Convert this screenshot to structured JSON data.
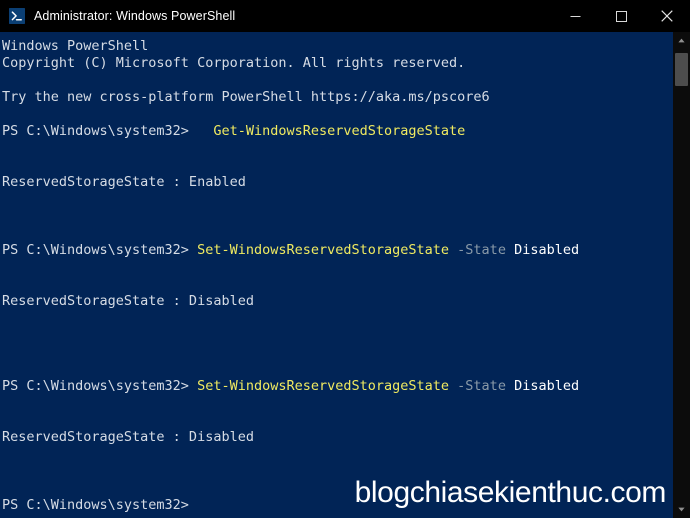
{
  "window": {
    "title": "Administrator: Windows PowerShell",
    "icon": "powershell-icon",
    "background_color": "#012456",
    "titlebar_color": "#000000",
    "controls": {
      "minimize": "minimize-icon",
      "maximize": "maximize-icon",
      "close": "close-icon"
    }
  },
  "scrollbar": {
    "up_arrow": "scroll-up-icon",
    "down_arrow": "scroll-down-icon"
  },
  "colors": {
    "prompt": "#d6dce5",
    "cmdlet": "#f0ea60",
    "parameter": "#8a9aa8",
    "argument": "#ffffff",
    "output": "#d6dce5"
  },
  "console": {
    "lines": [
      {
        "id": "banner-product",
        "segments": [
          {
            "text": "Windows PowerShell",
            "style": "plain"
          }
        ]
      },
      {
        "id": "banner-copyright",
        "segments": [
          {
            "text": "Copyright (C) Microsoft Corporation. All rights reserved.",
            "style": "plain"
          }
        ]
      },
      {
        "id": "blank-1",
        "segments": []
      },
      {
        "id": "banner-pscore",
        "segments": [
          {
            "text": "Try the new cross-platform PowerShell https://aka.ms/pscore6",
            "style": "plain"
          }
        ]
      },
      {
        "id": "blank-2",
        "segments": []
      },
      {
        "id": "cmd-1",
        "segments": [
          {
            "text": "PS C:\\Windows\\system32> ",
            "style": "prompt"
          },
          {
            "text": "  Get-WindowsReservedStorageState",
            "style": "cmdlet"
          }
        ]
      },
      {
        "id": "blank-3",
        "segments": []
      },
      {
        "id": "blank-4",
        "segments": []
      },
      {
        "id": "out-1",
        "segments": [
          {
            "text": "ReservedStorageState : Enabled",
            "style": "plain"
          }
        ]
      },
      {
        "id": "blank-5",
        "segments": []
      },
      {
        "id": "blank-6",
        "segments": []
      },
      {
        "id": "blank-7",
        "segments": []
      },
      {
        "id": "cmd-2",
        "segments": [
          {
            "text": "PS C:\\Windows\\system32> ",
            "style": "prompt"
          },
          {
            "text": "Set-WindowsReservedStorageState",
            "style": "cmdlet"
          },
          {
            "text": " -State",
            "style": "param"
          },
          {
            "text": " Disabled",
            "style": "arg"
          }
        ]
      },
      {
        "id": "blank-8",
        "segments": []
      },
      {
        "id": "blank-9",
        "segments": []
      },
      {
        "id": "out-2",
        "segments": [
          {
            "text": "ReservedStorageState : Disabled",
            "style": "plain"
          }
        ]
      },
      {
        "id": "blank-10",
        "segments": []
      },
      {
        "id": "blank-11",
        "segments": []
      },
      {
        "id": "blank-12",
        "segments": []
      },
      {
        "id": "blank-13",
        "segments": []
      },
      {
        "id": "cmd-3",
        "segments": [
          {
            "text": "PS C:\\Windows\\system32> ",
            "style": "prompt"
          },
          {
            "text": "Set-WindowsReservedStorageState",
            "style": "cmdlet"
          },
          {
            "text": " -State",
            "style": "param"
          },
          {
            "text": " Disabled",
            "style": "arg"
          }
        ]
      },
      {
        "id": "blank-14",
        "segments": []
      },
      {
        "id": "blank-15",
        "segments": []
      },
      {
        "id": "out-3",
        "segments": [
          {
            "text": "ReservedStorageState : Disabled",
            "style": "plain"
          }
        ]
      },
      {
        "id": "blank-16",
        "segments": []
      },
      {
        "id": "blank-17",
        "segments": []
      },
      {
        "id": "blank-18",
        "segments": []
      },
      {
        "id": "cmd-4",
        "segments": [
          {
            "text": "PS C:\\Windows\\system32>",
            "style": "prompt"
          }
        ]
      }
    ]
  },
  "watermark": {
    "text": "blogchiasekienthuc.com"
  }
}
